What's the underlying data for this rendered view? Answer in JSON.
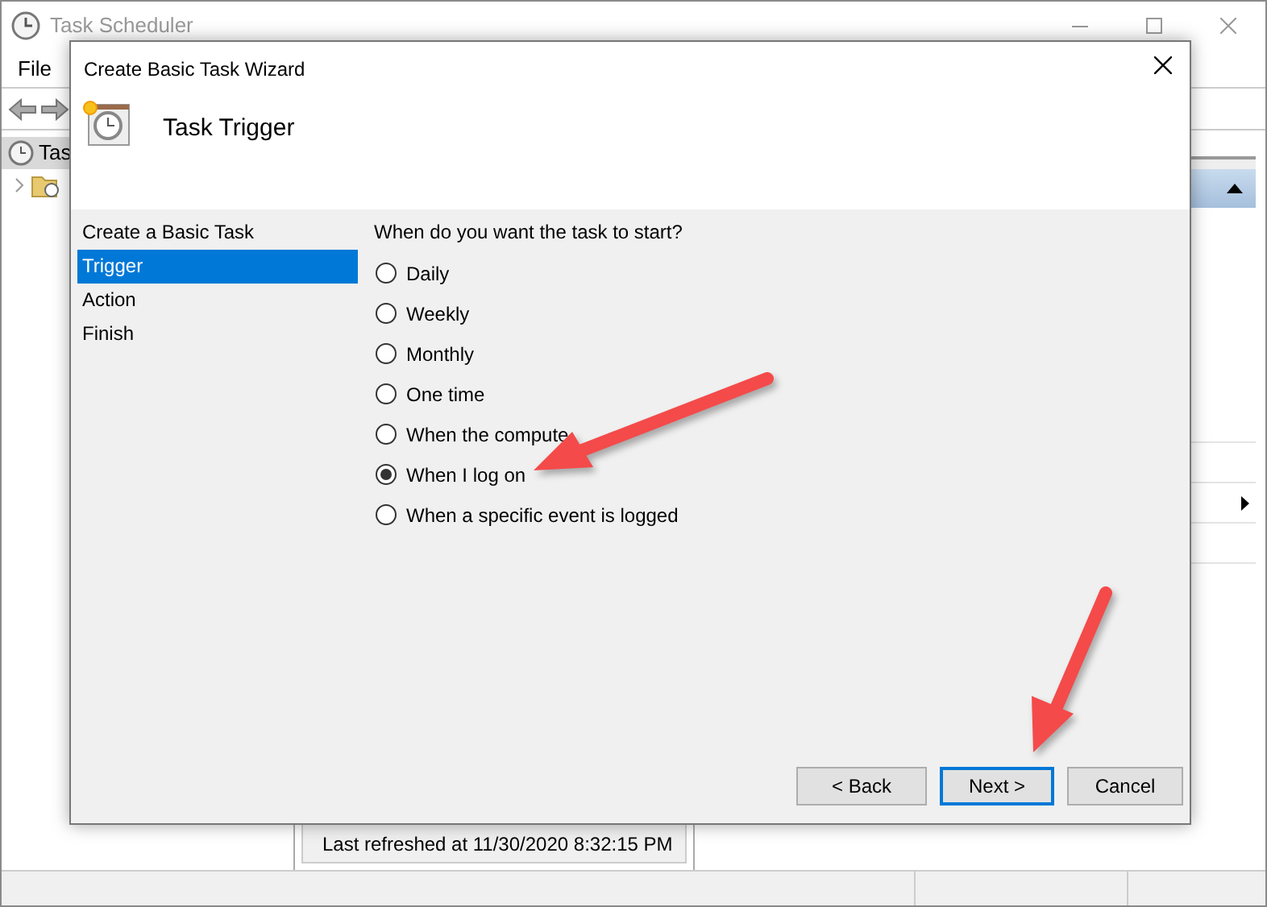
{
  "app_window": {
    "title": "Task Scheduler",
    "menu": [
      "File"
    ],
    "tree": {
      "items": [
        {
          "label": "Tas",
          "selected": true
        }
      ]
    },
    "middle_pane": {
      "status": "Last refreshed at 11/30/2020 8:32:15 PM"
    }
  },
  "dialog": {
    "title": "Create Basic Task Wizard",
    "heading": "Task Trigger",
    "steps": [
      {
        "label": "Create a Basic Task",
        "selected": false
      },
      {
        "label": "Trigger",
        "selected": true
      },
      {
        "label": "Action",
        "selected": false
      },
      {
        "label": "Finish",
        "selected": false
      }
    ],
    "question": "When do you want the task to start?",
    "options": [
      {
        "label": "Daily",
        "selected": false
      },
      {
        "label": "Weekly",
        "selected": false
      },
      {
        "label": "Monthly",
        "selected": false
      },
      {
        "label": "One time",
        "selected": false
      },
      {
        "label": "When the compute",
        "selected": false
      },
      {
        "label": "When I log on",
        "selected": true
      },
      {
        "label": "When a specific event is logged",
        "selected": false
      }
    ],
    "buttons": [
      {
        "label": "< Back",
        "default": false
      },
      {
        "label": "Next >",
        "default": true
      },
      {
        "label": "Cancel",
        "default": false
      }
    ]
  }
}
